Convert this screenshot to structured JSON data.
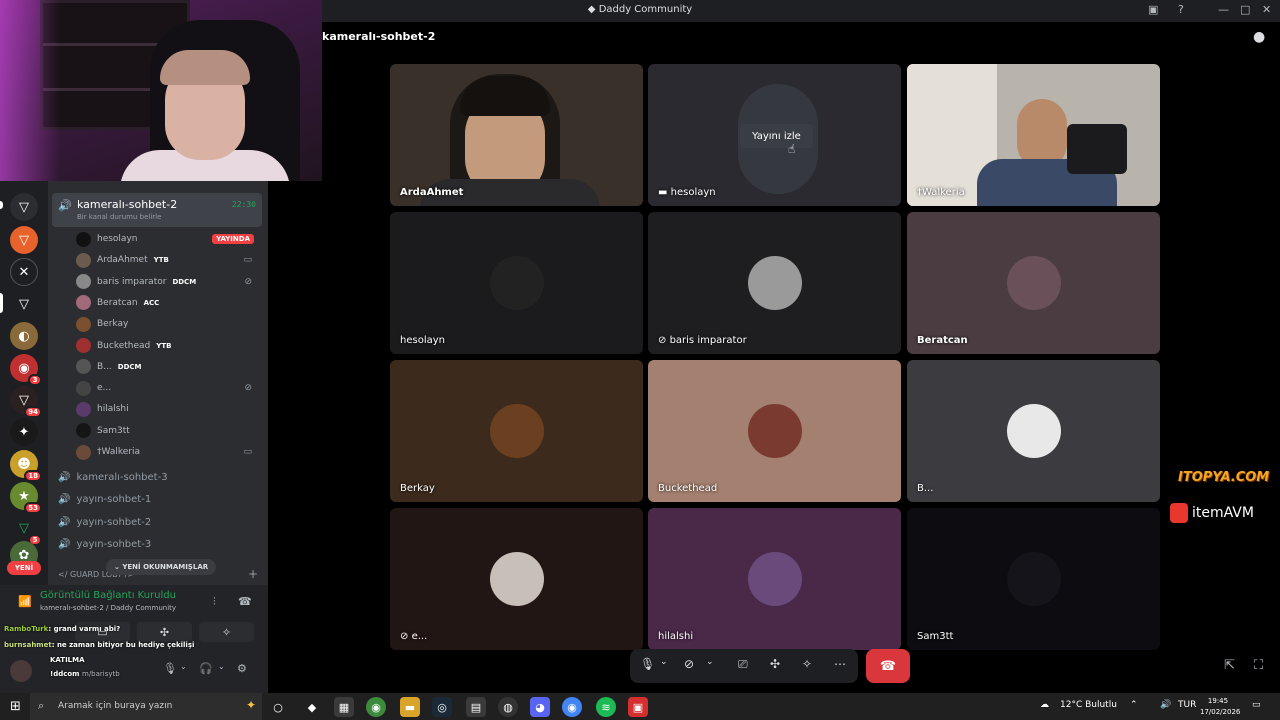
{
  "window": {
    "title": "Daddy Community",
    "title_icon": "discord-logo-icon"
  },
  "header": {
    "channel_title": "kameralı-sohbet-2"
  },
  "sidebar": {
    "active_channel": {
      "name": "kameralı-sohbet-2",
      "status_hint": "Bir kanal durumu belirle",
      "timer": "22:30"
    },
    "voice_users": [
      {
        "name": "hesolayn",
        "badge": "",
        "live_badge": "YAYINDA",
        "avatar_color": "#111111"
      },
      {
        "name": "ArdaAhmet",
        "badge": "YTB",
        "avatar_color": "#6b5a4e"
      },
      {
        "name": "baris imparator",
        "badge": "DDCM",
        "avatar_color": "#888888"
      },
      {
        "name": "Beratcan",
        "badge": "ACC",
        "avatar_color": "#a06a7a"
      },
      {
        "name": "Berkay",
        "badge": "",
        "avatar_color": "#7a5030"
      },
      {
        "name": "Buckethead",
        "badge": "YTB",
        "avatar_color": "#a03030"
      },
      {
        "name": "B...",
        "badge": "DDCM",
        "avatar_color": "#555555"
      },
      {
        "name": "e...",
        "badge": "",
        "avatar_color": "#444444"
      },
      {
        "name": "hilalshi",
        "badge": "",
        "avatar_color": "#5a3a6a"
      },
      {
        "name": "Sam3tt",
        "badge": "",
        "avatar_color": "#151515"
      },
      {
        "name": "†Walkeria",
        "badge": "",
        "avatar_color": "#6b4a3a"
      }
    ],
    "voice_channels": [
      "kameralı-sohbet-3",
      "yayın-sohbet-1",
      "yayın-sohbet-2",
      "yayın-sohbet-3"
    ],
    "unread_pill": "YENİ OKUNMAMIŞLAR",
    "category": "</ GUARD LOBY />",
    "server_new_badge": "YENİ",
    "server_badges": [
      "3",
      "94",
      "18",
      "53",
      "5"
    ]
  },
  "voice_panel": {
    "status": "Görüntülü Bağlantı Kuruldu",
    "location": "kameralı-sohbet-2 / Daddy Community"
  },
  "overlay_chat": [
    {
      "user": "RamboTurk",
      "text": ": grand varmı abi?"
    },
    {
      "user": "burnsahmet",
      "text": ": ne zaman bitiyor bu hediye çekilişi"
    },
    {
      "user": "",
      "text": "KATILMA"
    },
    {
      "user": "",
      "text": "!ddcom"
    },
    {
      "user": "",
      "text": "m/barisytb"
    }
  ],
  "grid": {
    "watch_stream_label": "Yayını izle",
    "tiles": [
      {
        "name": "ArdaAhmet",
        "bg": "#3a302a",
        "kind": "video1"
      },
      {
        "name": "hesolayn",
        "bg": "#2a2a30",
        "kind": "stream"
      },
      {
        "name": "†Walkeria",
        "bg": "#b8b4ac",
        "kind": "video2"
      },
      {
        "name": "hesolayn",
        "bg": "#1b1b1d",
        "avatar": "#222222"
      },
      {
        "name": "baris imparator",
        "bg": "#1e1e20",
        "avatar": "#9a9a9a"
      },
      {
        "name": "Beratcan",
        "bg": "#4a3c40",
        "avatar": "#6a5058"
      },
      {
        "name": "Berkay",
        "bg": "#3c2a1c",
        "avatar": "#6b4020"
      },
      {
        "name": "Buckethead",
        "bg": "#a48070",
        "avatar": "#7a3a30"
      },
      {
        "name": "B...",
        "bg": "#3c3c40",
        "avatar": "#e8e8e8"
      },
      {
        "name": "e...",
        "bg": "#221614",
        "avatar": "#c8c0b8"
      },
      {
        "name": "hilalshi",
        "bg": "#4a2848",
        "avatar": "#6a4a7a"
      },
      {
        "name": "Sam3tt",
        "bg": "#0d0c10",
        "avatar": "#15141a"
      }
    ]
  },
  "sponsors": {
    "s1": "ITOPYA.COM",
    "s2": "itemAVM"
  },
  "taskbar": {
    "search_placeholder": "Aramak için buraya yazın",
    "weather": "12°C  Bulutlu",
    "lang": "TUR",
    "time": "19:45",
    "date": "17/02/2026"
  }
}
